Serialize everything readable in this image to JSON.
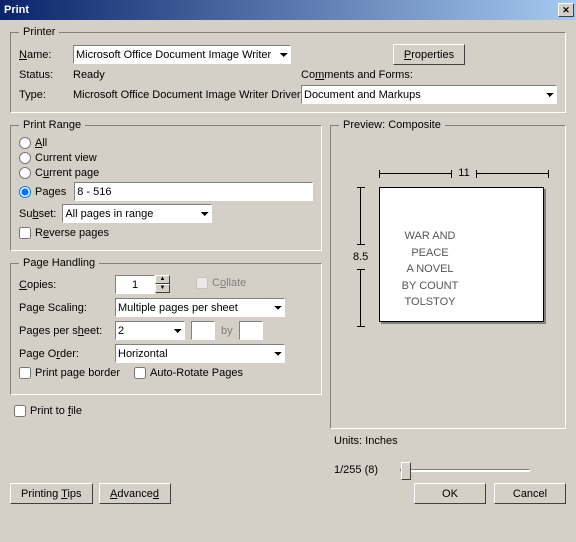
{
  "window": {
    "title": "Print"
  },
  "printer": {
    "legend": "Printer",
    "name_label": "Name:",
    "name_value": "Microsoft Office Document Image Writer",
    "properties_btn": "Properties",
    "status_label": "Status:",
    "status_value": "Ready",
    "type_label": "Type:",
    "type_value": "Microsoft Office Document Image Writer Driver",
    "comments_label": "Comments and Forms:",
    "comments_value": "Document and Markups"
  },
  "range": {
    "legend": "Print Range",
    "all": "All",
    "current_view": "Current view",
    "current_page": "Current page",
    "pages_label": "Pages",
    "pages_value": "8 - 516",
    "subset_label": "Subset:",
    "subset_value": "All pages in range",
    "reverse": "Reverse pages"
  },
  "handling": {
    "legend": "Page Handling",
    "copies_label": "Copies:",
    "copies_value": "1",
    "collate": "Collate",
    "scaling_label": "Page Scaling:",
    "scaling_value": "Multiple pages per sheet",
    "pps_label": "Pages per sheet:",
    "pps_value": "2",
    "by": "by",
    "order_label": "Page Order:",
    "order_value": "Horizontal",
    "border": "Print page border",
    "autorotate": "Auto-Rotate Pages"
  },
  "preview": {
    "legend": "Preview: Composite",
    "width": "11",
    "height": "8.5",
    "units": "Units: Inches",
    "progress": "1/255 (8)",
    "doc_title": "WAR AND PEACE",
    "doc_sub": "A NOVEL",
    "doc_author": "BY COUNT TOLSTOY"
  },
  "misc": {
    "print_to_file": "Print to file",
    "tips": "Printing Tips",
    "advanced": "Advanced",
    "ok": "OK",
    "cancel": "Cancel"
  }
}
